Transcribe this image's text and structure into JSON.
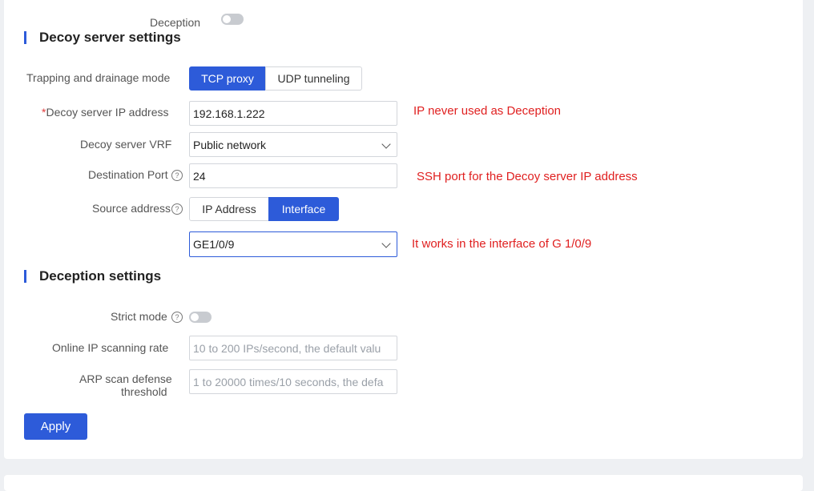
{
  "top": {
    "cut_label": ""
  },
  "deception_toggle": {
    "label": "Deception",
    "on": false
  },
  "decoy_section": {
    "title": "Decoy server settings"
  },
  "trapping": {
    "label": "Trapping and drainage mode",
    "options": [
      "TCP proxy",
      "UDP tunneling"
    ],
    "selected": "TCP proxy"
  },
  "decoy_ip": {
    "required_mark": "*",
    "label": "Decoy server IP address",
    "value": "192.168.1.222",
    "note": "IP never used as Deception"
  },
  "decoy_vrf": {
    "label": "Decoy server VRF",
    "value": "Public network"
  },
  "dest_port": {
    "label": "Destination Port",
    "value": "24",
    "note": "SSH port for the Decoy server IP address"
  },
  "source_address": {
    "label": "Source address",
    "options": [
      "IP Address",
      "Interface"
    ],
    "selected": "Interface",
    "interface_value": "GE1/0/9",
    "note": "It works in the interface of G 1/0/9"
  },
  "deception_section": {
    "title": "Deception settings"
  },
  "strict_mode": {
    "label": "Strict mode",
    "on": false
  },
  "scan_rate": {
    "label": "Online IP scanning rate",
    "placeholder": "10 to 200 IPs/second, the default valu"
  },
  "arp_threshold": {
    "label_line1": "ARP scan defense",
    "label_line2": "threshold",
    "placeholder": "1 to 20000 times/10 seconds, the defa"
  },
  "apply": {
    "label": "Apply"
  },
  "colors": {
    "accent": "#2d5bd9",
    "note": "#e02020",
    "toggle_off": "#c8cbd0"
  }
}
